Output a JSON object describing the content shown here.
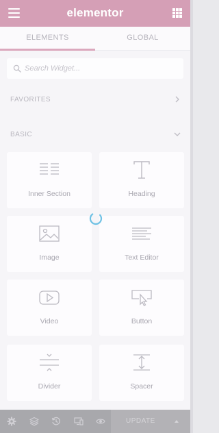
{
  "header": {
    "logo": "elementor",
    "menu_icon": "hamburger-icon",
    "apps_icon": "grid-icon"
  },
  "tabs": [
    {
      "label": "ELEMENTS",
      "active": true
    },
    {
      "label": "GLOBAL",
      "active": false
    }
  ],
  "search": {
    "placeholder": "Search Widget...",
    "value": "",
    "icon": "search-icon"
  },
  "sections": {
    "favorites": {
      "label": "FAVORITES",
      "expanded": false
    },
    "basic": {
      "label": "BASIC",
      "expanded": true
    }
  },
  "widgets": [
    {
      "label": "Inner Section",
      "icon": "inner-section-icon"
    },
    {
      "label": "Heading",
      "icon": "heading-icon"
    },
    {
      "label": "Image",
      "icon": "image-icon"
    },
    {
      "label": "Text Editor",
      "icon": "text-editor-icon"
    },
    {
      "label": "Video",
      "icon": "video-icon"
    },
    {
      "label": "Button",
      "icon": "button-icon"
    },
    {
      "label": "Divider",
      "icon": "divider-icon"
    },
    {
      "label": "Spacer",
      "icon": "spacer-icon"
    }
  ],
  "footer": {
    "update_label": "UPDATE",
    "icons": [
      "settings-icon",
      "navigator-icon",
      "history-icon",
      "responsive-icon",
      "preview-icon"
    ]
  },
  "colors": {
    "header": "#d59fb6",
    "active_tab_underline": "#dba8bd",
    "spinner": "#6ec1e4",
    "footer": "#a8a8ac"
  }
}
